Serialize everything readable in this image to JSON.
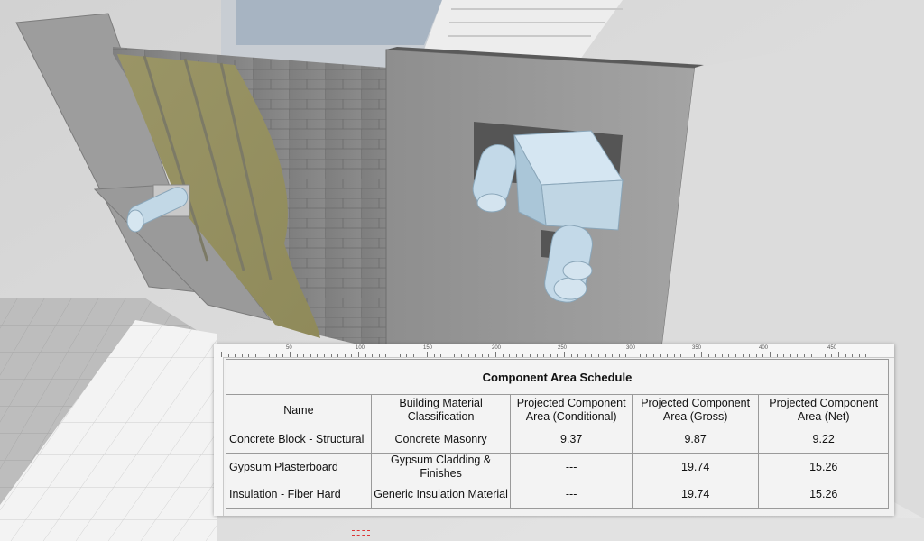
{
  "schedule": {
    "title": "Component Area Schedule",
    "columns": [
      "Name",
      "Building Material Classification",
      "Projected Component Area (Conditional)",
      "Projected Component Area (Gross)",
      "Projected Component Area (Net)"
    ],
    "rows": [
      [
        "Concrete Block - Structural",
        "Concrete Masonry",
        "9.37",
        "9.87",
        "9.22"
      ],
      [
        "Gypsum Plasterboard",
        "Gypsum Cladding & Finishes",
        "---",
        "19.74",
        "15.26"
      ],
      [
        "Insulation - Fiber Hard",
        "Generic Insulation Material",
        "---",
        "19.74",
        "15.26"
      ]
    ]
  },
  "ruler": {
    "labels": [
      "50",
      "100",
      "150",
      "200",
      "250",
      "300",
      "350",
      "400",
      "450"
    ]
  }
}
